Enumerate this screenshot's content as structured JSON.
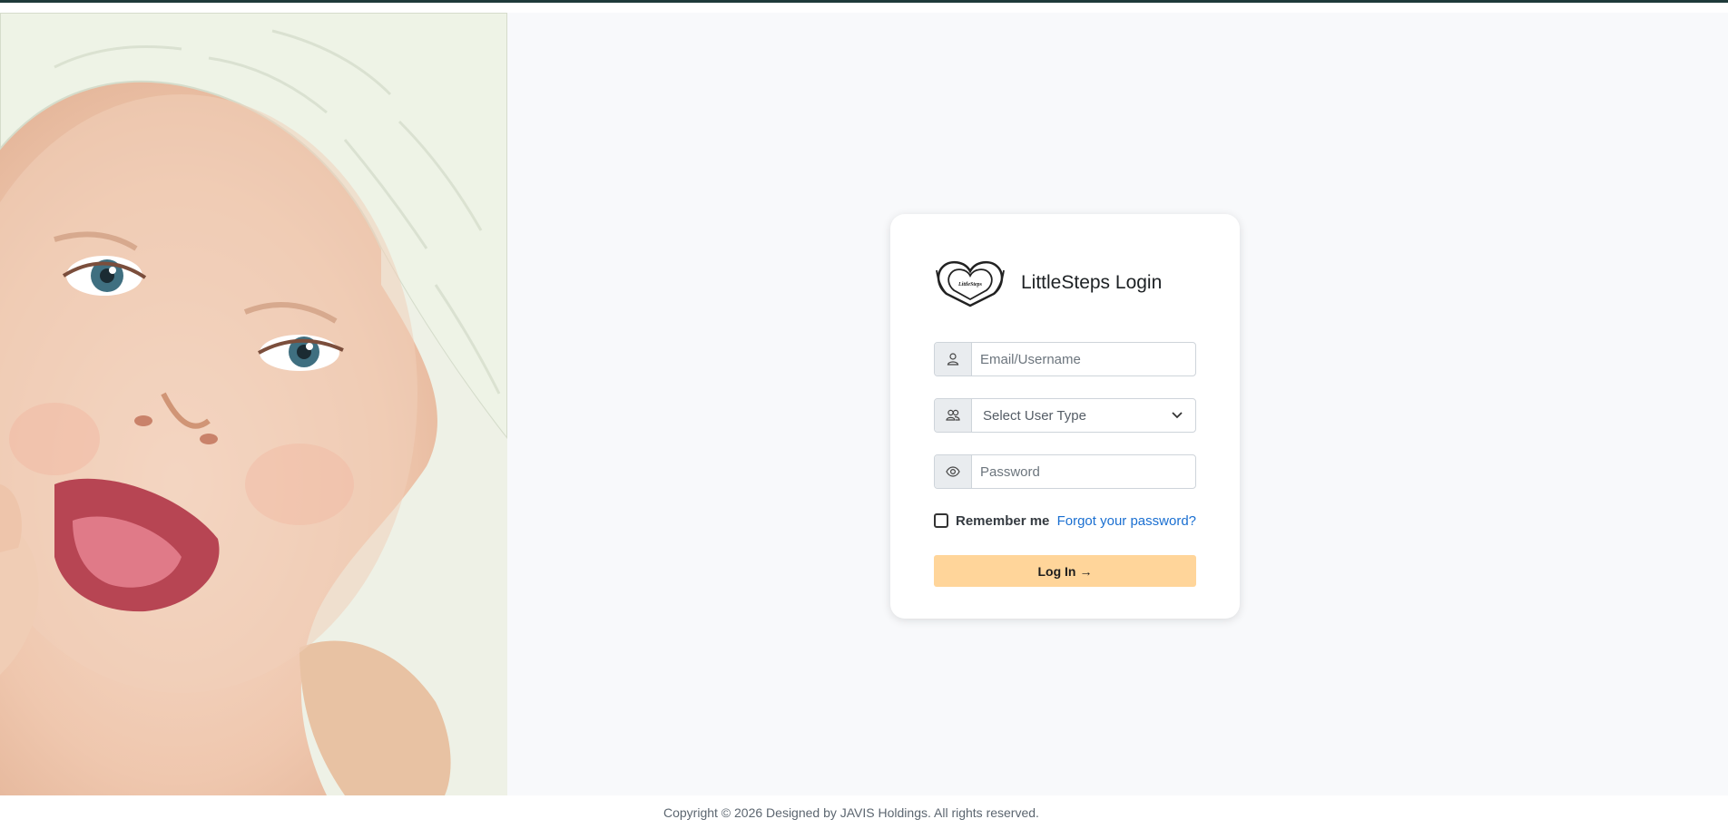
{
  "login": {
    "title": "LittleSteps Login",
    "logo_text": "LittleSteps",
    "username_placeholder": "Email/Username",
    "user_type_selected": "Select User Type",
    "password_placeholder": "Password",
    "remember_label": "Remember me",
    "forgot_label": "Forgot your password?",
    "login_label": "Log In",
    "login_arrow": "→"
  },
  "footer": {
    "copyright": "Copyright © 2026 Designed by JAVIS Holdings. All rights reserved."
  },
  "colors": {
    "login_button": "#ffd59a",
    "link": "#1a6fd1",
    "top_bar": "#1f3a3a"
  },
  "icons": {
    "username": "user-icon",
    "user_type": "users-icon",
    "password": "eye-icon",
    "dropdown": "chevron-down-icon"
  }
}
